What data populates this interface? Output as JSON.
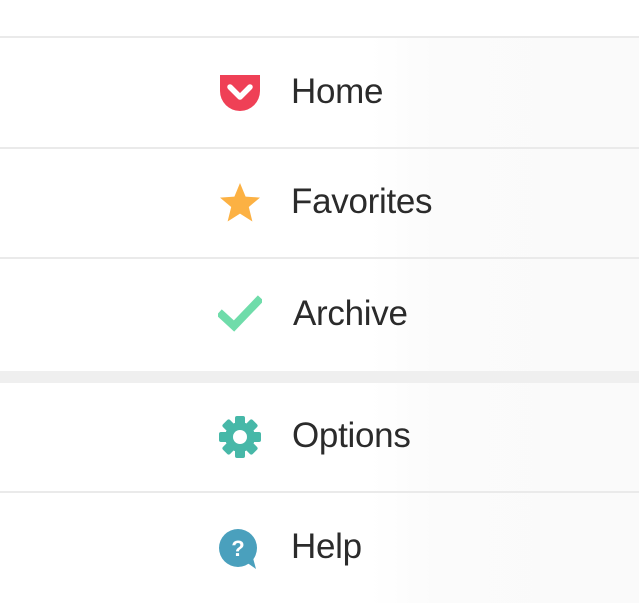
{
  "menu": {
    "items": [
      {
        "label": "Home",
        "icon": "pocket-icon",
        "color": "#ef4056"
      },
      {
        "label": "Favorites",
        "icon": "star-icon",
        "color": "#fcb143"
      },
      {
        "label": "Archive",
        "icon": "checkmark-icon",
        "color": "#6fdcaa"
      },
      {
        "label": "Options",
        "icon": "gear-icon",
        "color": "#47b8a8"
      },
      {
        "label": "Help",
        "icon": "help-bubble-icon",
        "color": "#4aa0bd"
      }
    ]
  }
}
